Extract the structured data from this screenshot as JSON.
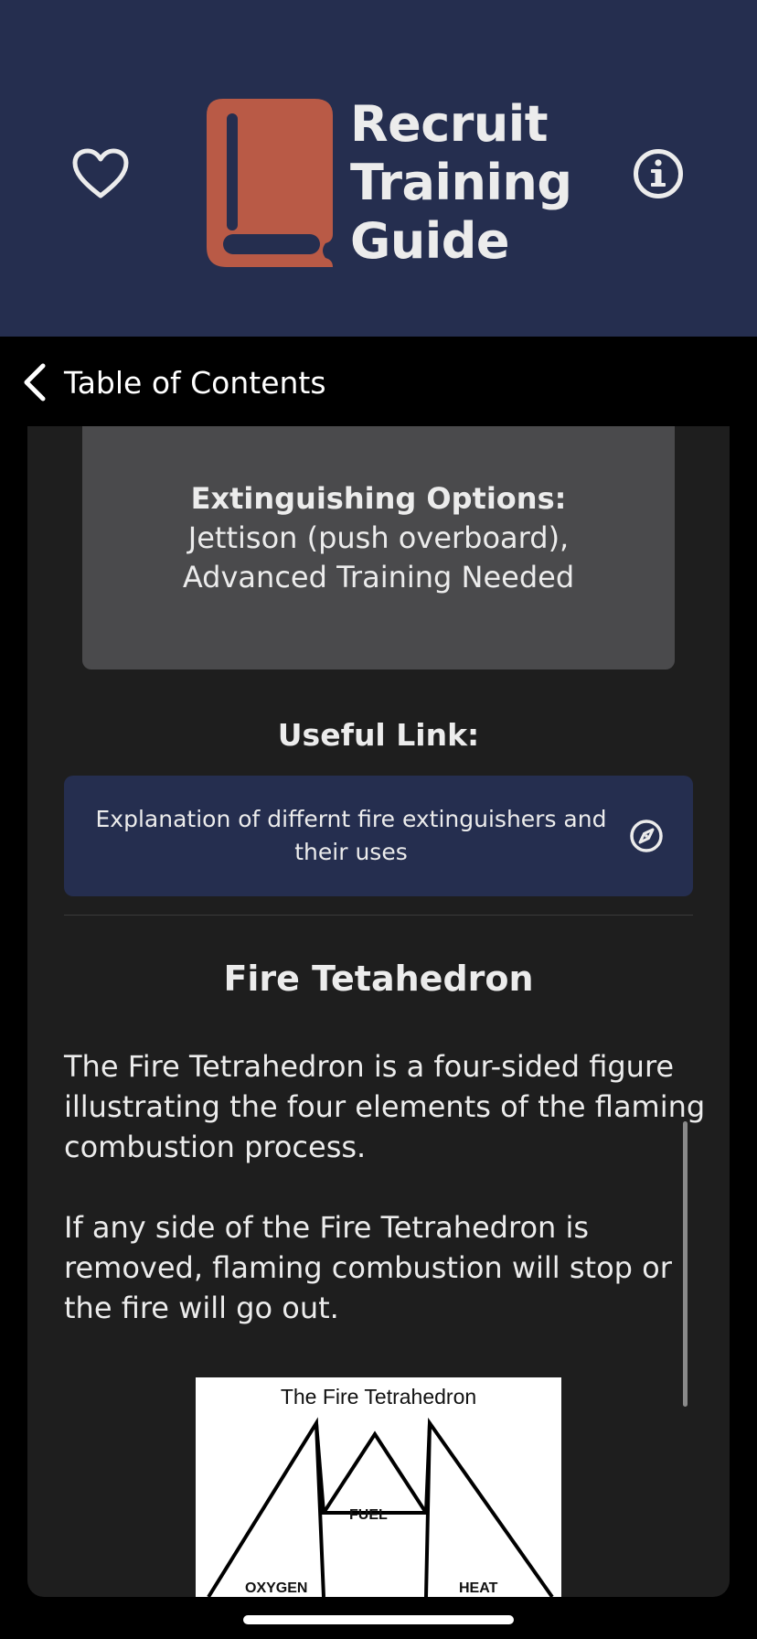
{
  "header": {
    "title": "Recruit\nTraining\nGuide",
    "accent_color": "#b95a46",
    "background_color": "#252e4f",
    "left_icon": "heart-icon",
    "right_icon": "info-icon",
    "logo_icon": "book-icon"
  },
  "nav": {
    "back_label": "Table of Contents",
    "back_icon": "chevron-left-icon"
  },
  "extinguishing": {
    "title": "Extinguishing Options:",
    "line1": "Jettison (push overboard),",
    "line2": "Advanced Training Needed"
  },
  "useful_link": {
    "label": "Useful Link:",
    "link_text": "Explanation of differnt fire extinguishers and their uses",
    "icon": "compass-icon"
  },
  "section": {
    "title": "Fire Tetahedron",
    "paragraph1": "The Fire Tetrahedron is a four-sided figure illustrating the four elements of the flaming combustion process.",
    "paragraph2": "If any side of the Fire Tetrahedron is removed, flaming combustion will stop or the fire will go out."
  },
  "diagram": {
    "title": "The Fire Tetrahedron",
    "labels": {
      "fuel": "FUEL",
      "oxygen": "OXYGEN",
      "heat": "HEAT"
    }
  }
}
